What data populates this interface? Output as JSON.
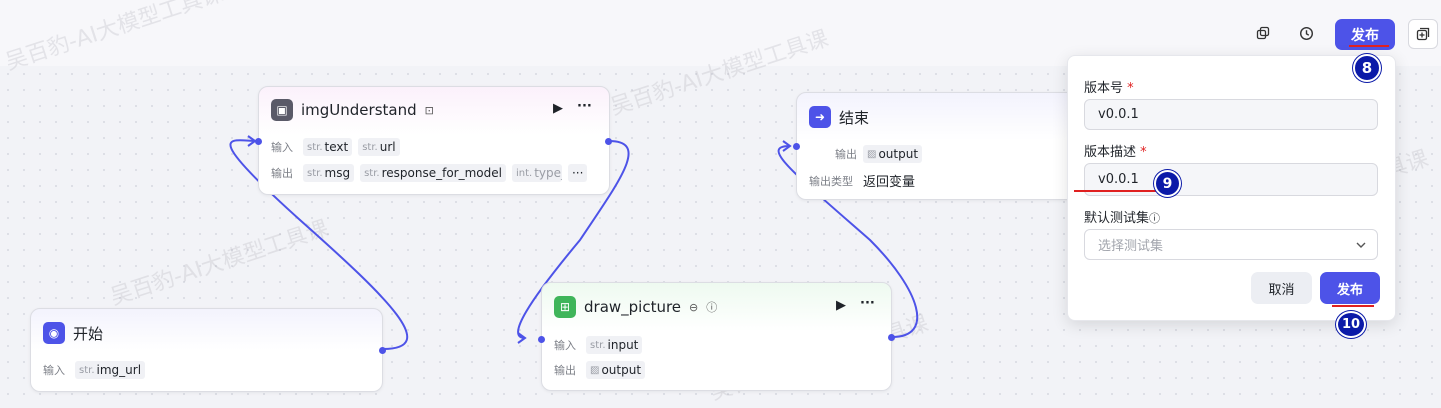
{
  "toolbar": {
    "publish_label": "发布",
    "icons": [
      "copy-icon",
      "history-icon",
      "add-panel-icon"
    ]
  },
  "annotations": {
    "badge_8": "8",
    "badge_9": "9",
    "badge_10": "10"
  },
  "watermark": "吴百豹-AI大模型工具课",
  "nodes": {
    "img_understand": {
      "title": "imgUnderstand",
      "input_label": "输入",
      "inputs": [
        {
          "type": "str.",
          "name": "text"
        },
        {
          "type": "str.",
          "name": "url"
        }
      ],
      "output_label": "输出",
      "outputs": [
        {
          "type": "str.",
          "name": "msg"
        },
        {
          "type": "str.",
          "name": "response_for_model"
        },
        {
          "type": "int.",
          "name": "type_"
        }
      ],
      "more": "···"
    },
    "end": {
      "title": "结束",
      "output_label": "输出",
      "output": "output",
      "output_type_label": "输出类型",
      "output_type_value": "返回变量"
    },
    "start": {
      "title": "开始",
      "input_label": "输入",
      "input": {
        "type": "str.",
        "name": "img_url"
      }
    },
    "draw_picture": {
      "title": "draw_picture",
      "input_label": "输入",
      "input": {
        "type": "str.",
        "name": "input"
      },
      "output_label": "输出",
      "output": "output"
    }
  },
  "popover": {
    "version_label": "版本号",
    "version_value": "v0.0.1",
    "desc_label": "版本描述",
    "desc_value": "v0.0.1",
    "testset_label": "默认测试集",
    "testset_placeholder": "选择测试集",
    "cancel_label": "取消",
    "publish_label": "发布",
    "required_mark": "*"
  },
  "colors": {
    "accent": "#4d53e8",
    "annotation_red": "#e02020",
    "badge_blue": "#0b1aa8"
  }
}
